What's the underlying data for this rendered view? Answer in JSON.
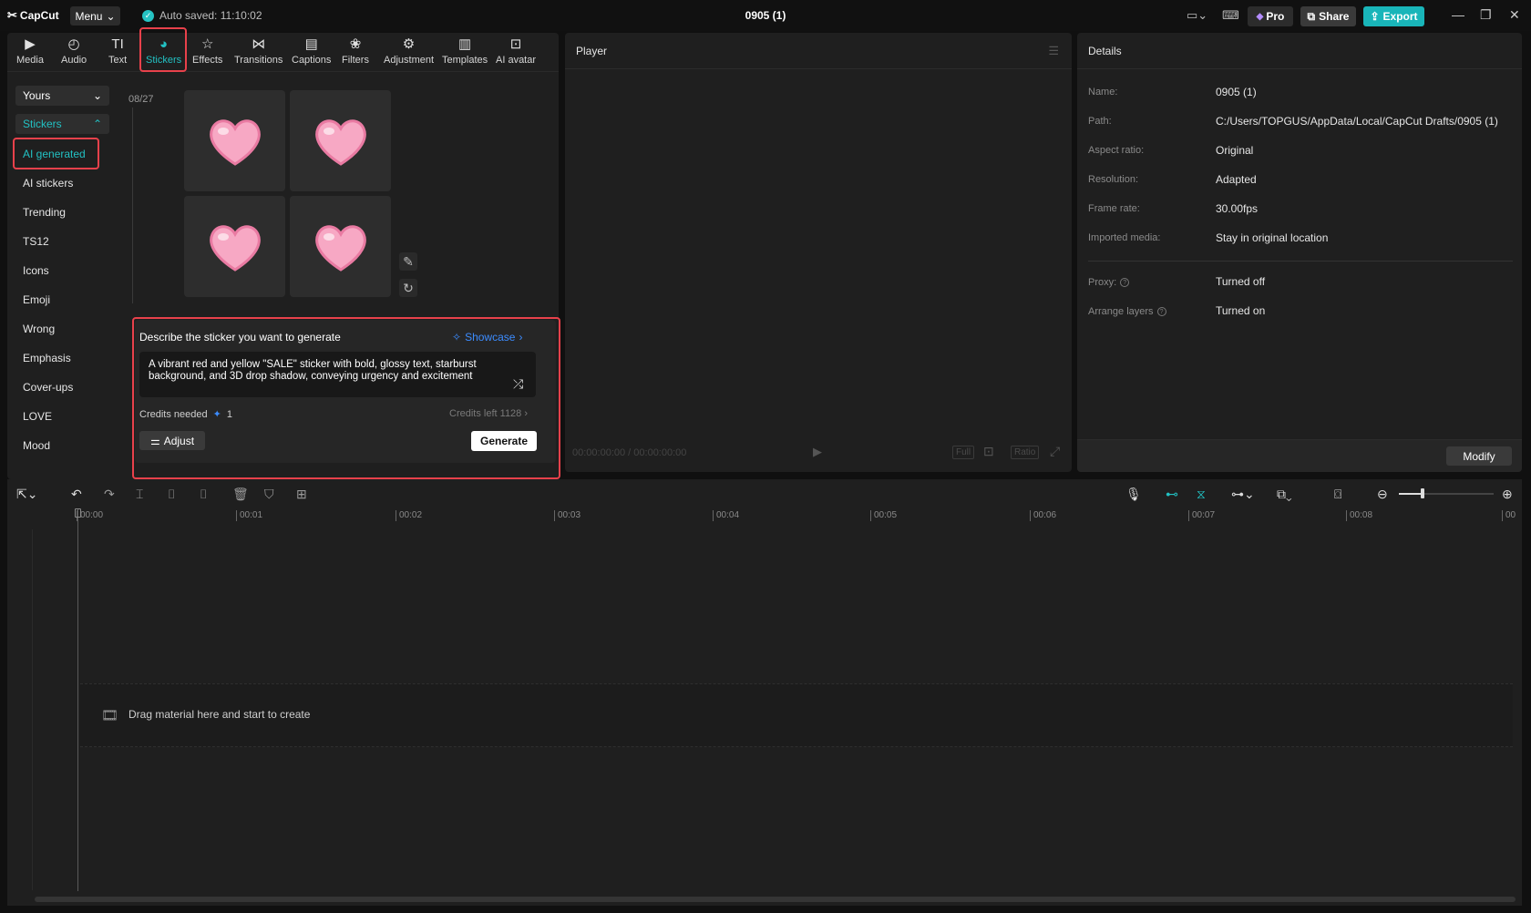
{
  "app": {
    "logo_text": "CapCut",
    "menu_label": "Menu",
    "autosave_text": "Auto saved: 11:10:02",
    "document_title": "0905 (1)",
    "pro_label": "Pro",
    "share_label": "Share",
    "export_label": "Export"
  },
  "toolbar": {
    "items": [
      {
        "label": "Media",
        "icon": "media-icon"
      },
      {
        "label": "Audio",
        "icon": "audio-icon"
      },
      {
        "label": "Text",
        "icon": "text-icon"
      },
      {
        "label": "Stickers",
        "icon": "stickers-icon",
        "active": true
      },
      {
        "label": "Effects",
        "icon": "effects-icon"
      },
      {
        "label": "Transitions",
        "icon": "transitions-icon"
      },
      {
        "label": "Captions",
        "icon": "captions-icon"
      },
      {
        "label": "Filters",
        "icon": "filters-icon"
      },
      {
        "label": "Adjustment",
        "icon": "adjustment-icon"
      },
      {
        "label": "Templates",
        "icon": "templates-icon"
      },
      {
        "label": "AI avatar",
        "icon": "ai-avatar-icon"
      }
    ]
  },
  "sidebar": {
    "yours_label": "Yours",
    "stickers_label": "Stickers",
    "items": [
      "AI generated",
      "AI stickers",
      "Trending",
      "TS12",
      "Icons",
      "Emoji",
      "Wrong",
      "Emphasis",
      "Cover-ups",
      "LOVE",
      "Mood"
    ]
  },
  "stickers_grid": {
    "date_label": "08/27",
    "tiles": [
      "heart-sticker",
      "heart-sticker",
      "heart-sticker",
      "heart-sticker"
    ]
  },
  "generator": {
    "title": "Describe the sticker you want to generate",
    "showcase_label": "Showcase",
    "prompt_text": "A vibrant red and yellow \"SALE\" sticker with bold, glossy text, starburst background, and 3D drop shadow, conveying urgency and excitement",
    "credits_needed_label": "Credits needed",
    "credits_needed_value": "1",
    "credits_left_label": "Credits left",
    "credits_left_value": "1128",
    "adjust_label": "Adjust",
    "generate_label": "Generate"
  },
  "player": {
    "title": "Player",
    "timecode": "00:00:00:00 / 00:00:00:00",
    "full_label": "Full",
    "ratio_label": "Ratio"
  },
  "details": {
    "title": "Details",
    "rows": [
      {
        "label": "Name:",
        "value": "0905 (1)"
      },
      {
        "label": "Path:",
        "value": "C:/Users/TOPGUS/AppData/Local/CapCut Drafts/0905 (1)"
      },
      {
        "label": "Aspect ratio:",
        "value": "Original"
      },
      {
        "label": "Resolution:",
        "value": "Adapted"
      },
      {
        "label": "Frame rate:",
        "value": "30.00fps"
      },
      {
        "label": "Imported media:",
        "value": "Stay in original location"
      }
    ],
    "rows2": [
      {
        "label": "Proxy:",
        "value": "Turned off"
      },
      {
        "label": "Arrange layers",
        "value": "Turned on"
      }
    ],
    "modify_label": "Modify"
  },
  "timeline": {
    "ticks": [
      "00:00",
      "00:01",
      "00:02",
      "00:03",
      "00:04",
      "00:05",
      "00:06",
      "00:07",
      "00:08",
      "00"
    ],
    "drop_text": "Drag material here and start to create",
    "zoom_level": 0.25
  },
  "colors": {
    "accent": "#22c1c3",
    "highlight": "#e8414b",
    "link": "#3c8cff",
    "export": "#19b5b9"
  }
}
